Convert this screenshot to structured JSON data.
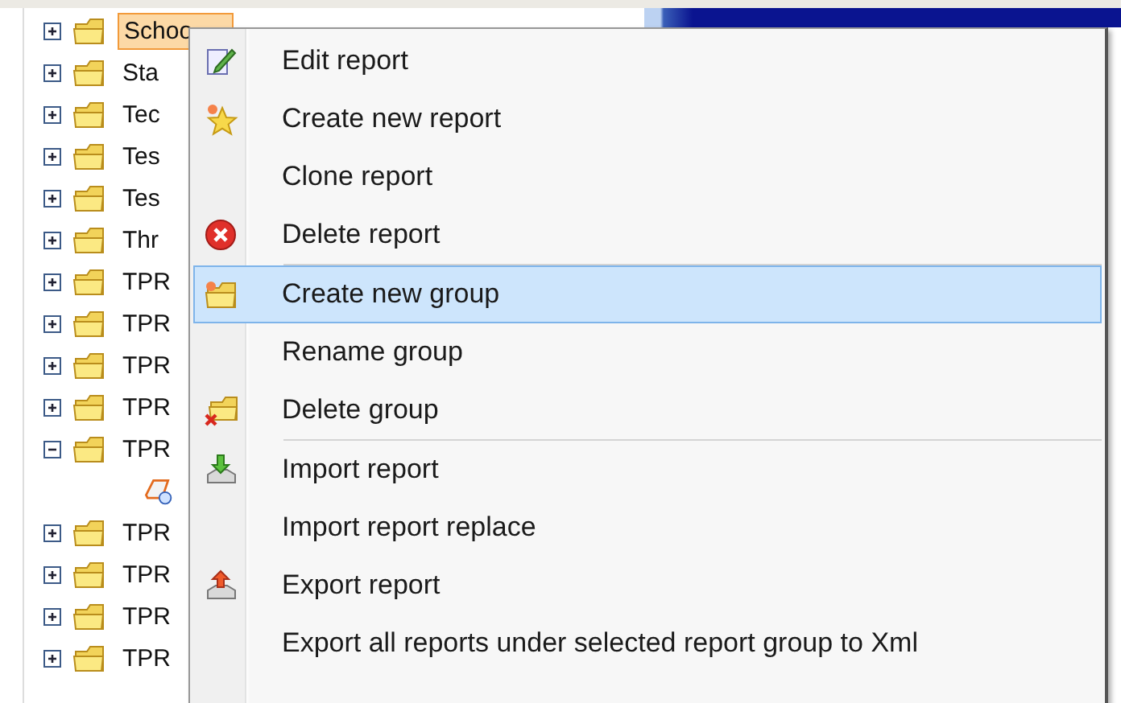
{
  "tree": [
    {
      "label": "Schoo",
      "selected": true,
      "expanded": false
    },
    {
      "label": "Sta",
      "selected": false,
      "expanded": false
    },
    {
      "label": "Tec",
      "selected": false,
      "expanded": false
    },
    {
      "label": "Tes",
      "selected": false,
      "expanded": false
    },
    {
      "label": "Tes",
      "selected": false,
      "expanded": false
    },
    {
      "label": "Thr",
      "selected": false,
      "expanded": false
    },
    {
      "label": "TPR",
      "selected": false,
      "expanded": false
    },
    {
      "label": "TPR",
      "selected": false,
      "expanded": false
    },
    {
      "label": "TPR",
      "selected": false,
      "expanded": false
    },
    {
      "label": "TPR",
      "selected": false,
      "expanded": false
    },
    {
      "label": "TPR",
      "selected": false,
      "expanded": true,
      "children": [
        {
          "kind": "report"
        }
      ]
    },
    {
      "label": "TPR",
      "selected": false,
      "expanded": false
    },
    {
      "label": "TPR",
      "selected": false,
      "expanded": false
    },
    {
      "label": "TPR",
      "selected": false,
      "expanded": false
    },
    {
      "label": "TPR",
      "selected": false,
      "expanded": false
    }
  ],
  "context_menu": [
    {
      "kind": "item",
      "label": "Edit report",
      "selected": false
    },
    {
      "kind": "item",
      "label": "Create new report",
      "selected": false
    },
    {
      "kind": "item",
      "label": "Clone report",
      "selected": false
    },
    {
      "kind": "item",
      "label": "Delete report",
      "selected": false
    },
    {
      "kind": "separator"
    },
    {
      "kind": "item",
      "label": "Create new group",
      "selected": true
    },
    {
      "kind": "item",
      "label": "Rename group",
      "selected": false
    },
    {
      "kind": "item",
      "label": "Delete group",
      "selected": false
    },
    {
      "kind": "separator"
    },
    {
      "kind": "item",
      "label": "Import report",
      "selected": false
    },
    {
      "kind": "item",
      "label": "Import report replace",
      "selected": false
    },
    {
      "kind": "item",
      "label": "Export report",
      "selected": false
    },
    {
      "kind": "item",
      "label": "Export all reports under selected report group to Xml",
      "selected": false
    }
  ]
}
